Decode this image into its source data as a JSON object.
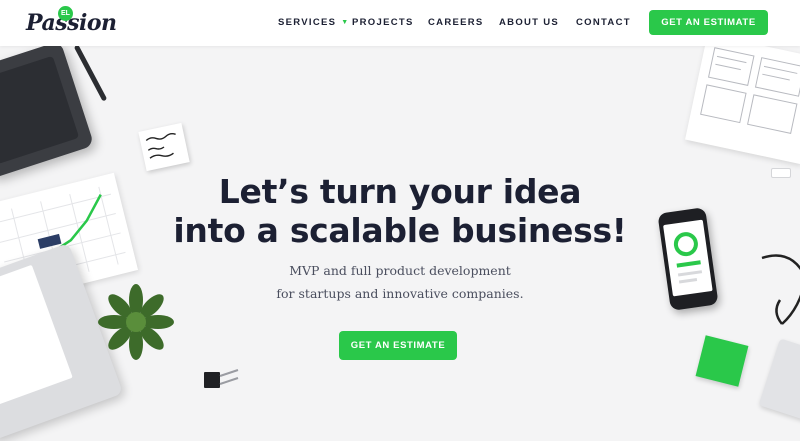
{
  "brand": {
    "badge_text": "EL",
    "name_text": "Passion",
    "accent_color": "#2ac84a",
    "text_color": "#1c2033"
  },
  "nav": {
    "items": [
      {
        "label": "SERVICES",
        "has_dropdown": true
      },
      {
        "label": "PROJECTS"
      },
      {
        "label": "CAREERS"
      },
      {
        "label": "ABOUT US"
      },
      {
        "label": "CONTACT"
      }
    ],
    "cta_label": "GET AN ESTIMATE"
  },
  "hero": {
    "title_line1": "Let’s turn your idea",
    "title_line2": "into a scalable business!",
    "subtitle_line1": "MVP and full product development",
    "subtitle_line2": "for startups and innovative companies.",
    "cta_label": "GET AN ESTIMATE"
  },
  "icons": {
    "dropdown": "chevron-down-icon"
  }
}
